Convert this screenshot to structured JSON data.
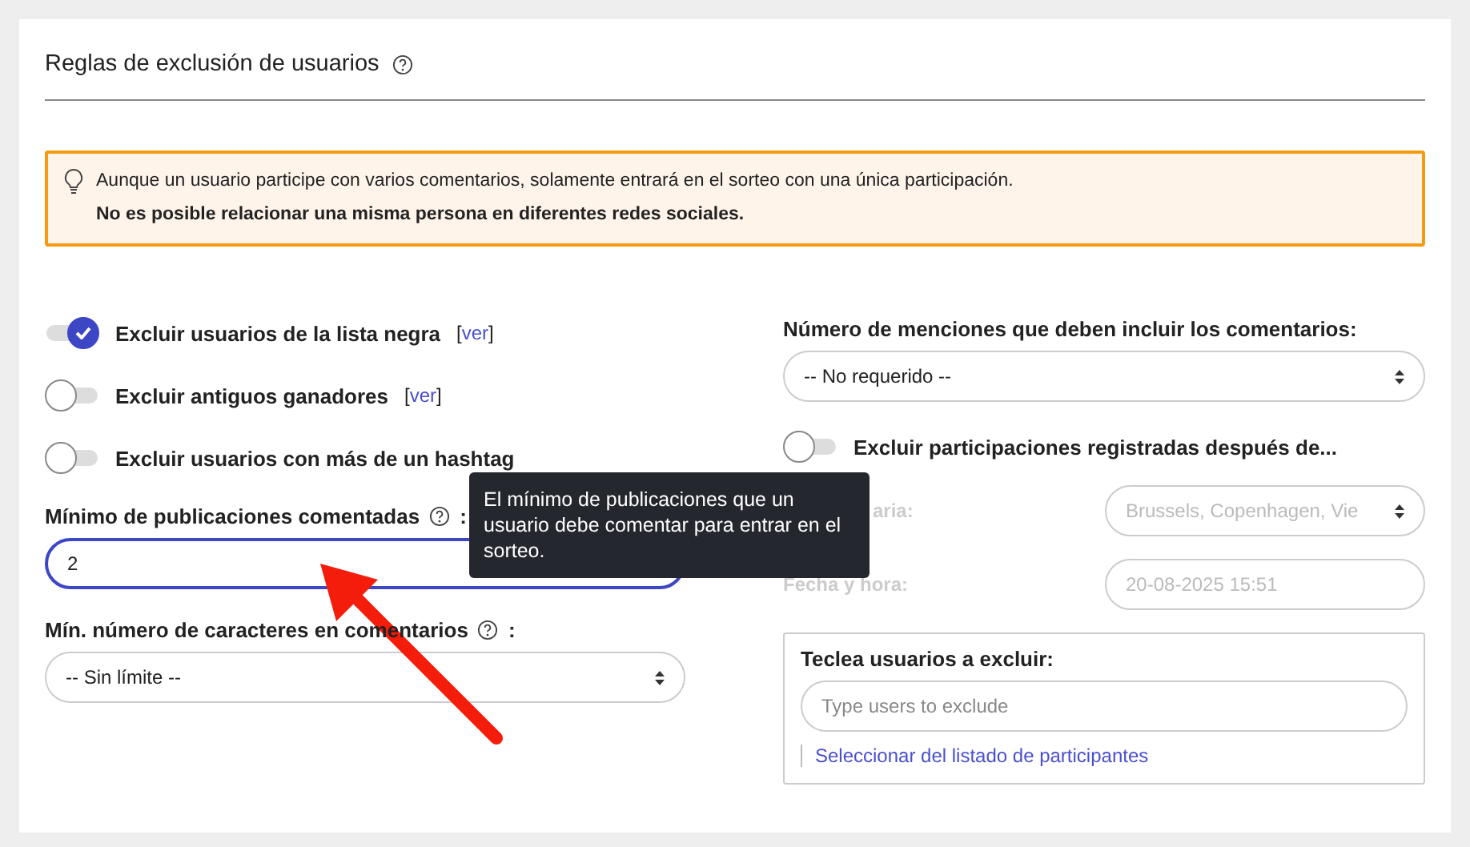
{
  "title": "Reglas de exclusión de usuarios",
  "alert": {
    "text": "Aunque un usuario participe con varios comentarios, solamente entrará en el sorteo con una única participación.",
    "bold_text": "No es posible relacionar una misma persona en diferentes redes sociales."
  },
  "toggles": [
    {
      "label": "Excluir usuarios de la lista negra",
      "bracket_open": "[",
      "link": "ver",
      "bracket_close": "]",
      "on": true
    },
    {
      "label": "Excluir antiguos ganadores",
      "bracket_open": "[",
      "link": "ver",
      "bracket_close": "]",
      "on": false
    },
    {
      "label": "Excluir usuarios con más de un hashtag",
      "on": false
    }
  ],
  "min_posts": {
    "label": "Mínimo de publicaciones comentadas",
    "suffix": ":",
    "value": "2"
  },
  "min_chars": {
    "label": "Mín. número de caracteres en comentarios",
    "suffix": ":",
    "value": "-- Sin límite --"
  },
  "tooltip": "El mínimo de publicaciones que un usuario debe comentar para entrar en el sorteo.",
  "mentions": {
    "label": "Número de menciones que deben incluir los comentarios:",
    "value": "-- No requerido --"
  },
  "after_toggle": {
    "label": "Excluir participaciones registradas después de...",
    "on": false
  },
  "timezone": {
    "label": "aria:",
    "value": "Brussels, Copenhagen, Vie",
    "disabled": true
  },
  "datetime": {
    "label": "Fecha y hora:",
    "value": "20-08-2025 15:51",
    "disabled": true
  },
  "exclude_users": {
    "label": "Teclea usuarios a excluir:",
    "placeholder": "Type users to exclude",
    "link": "Seleccionar del listado de participantes"
  }
}
